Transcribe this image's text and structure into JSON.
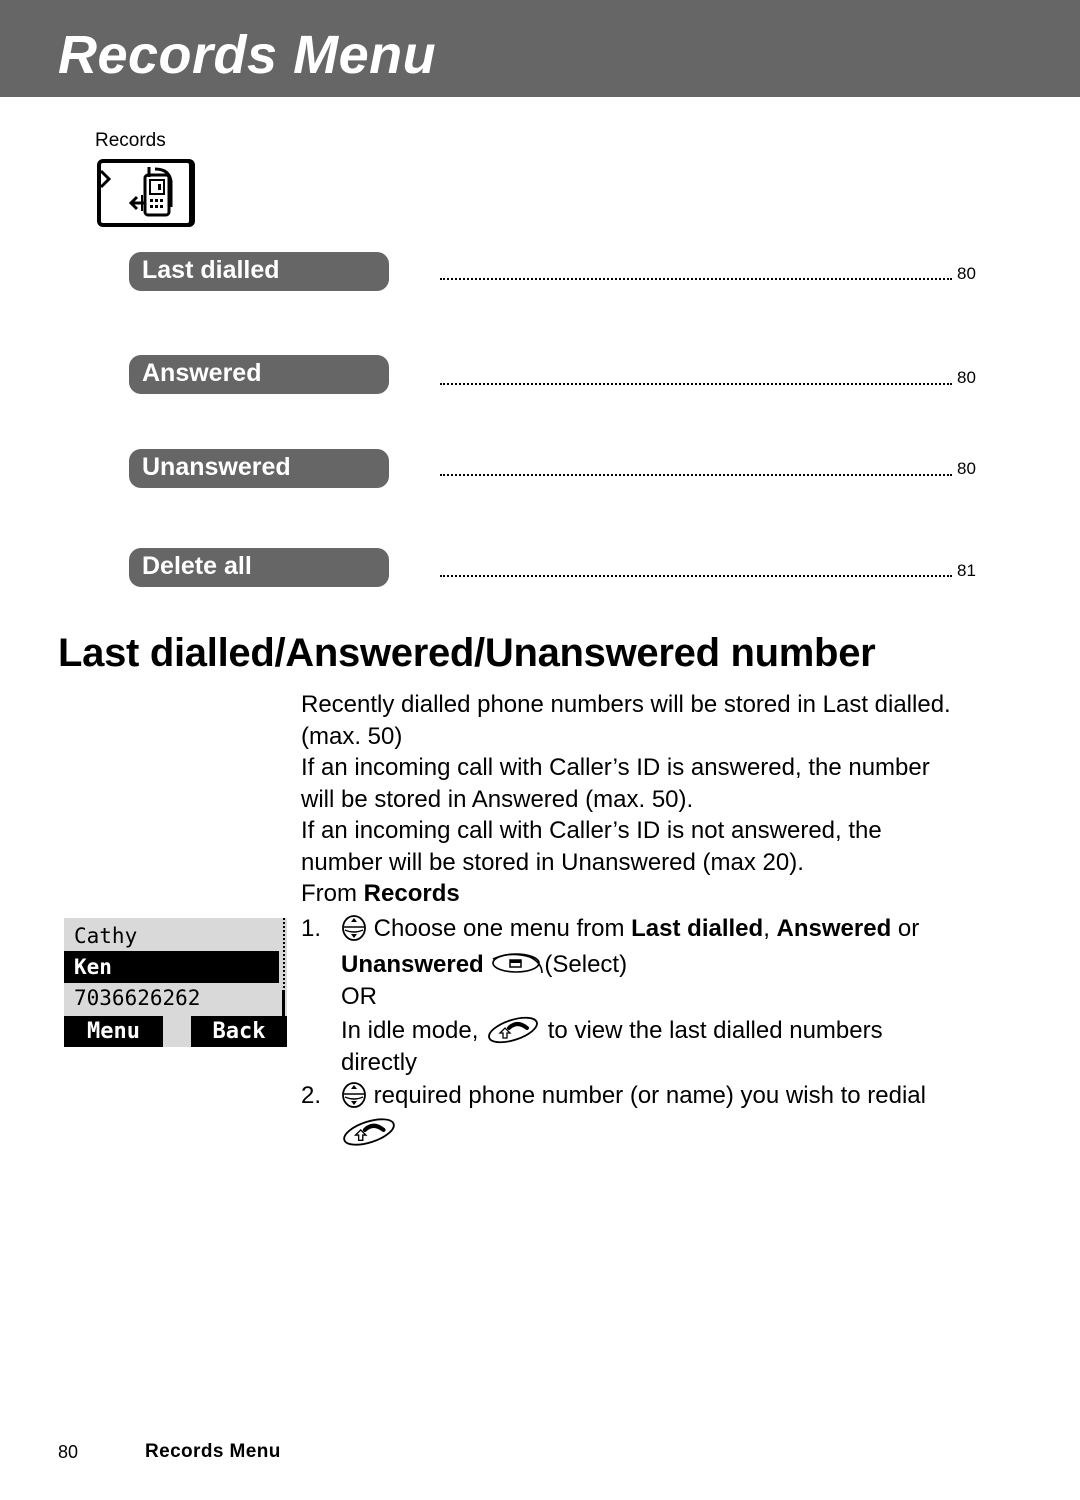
{
  "header": {
    "title": "Records Menu"
  },
  "records_section": {
    "label": "Records",
    "icon": "records-phone-icon"
  },
  "menu_items": [
    {
      "label": "Last dialled",
      "page": "80"
    },
    {
      "label": "Answered",
      "page": "80"
    },
    {
      "label": "Unanswered",
      "page": "80"
    },
    {
      "label": "Delete all",
      "page": "81"
    }
  ],
  "section": {
    "title": "Last dialled/Answered/Unanswered number",
    "paragraphs": [
      "Recently dialled phone numbers will be stored in Last dialled.",
      "(max. 50)",
      "If an incoming call with Caller’s ID is answered, the number",
      "will be stored in Answered (max. 50).",
      "If an incoming call with Caller’s ID is not answered, the",
      "number will be stored in Unanswered (max 20)."
    ],
    "from_prefix": "From ",
    "from_bold": "Records"
  },
  "steps": [
    {
      "num": "1.",
      "icon": "scroll-key-icon",
      "line1_text": " Choose one menu from ",
      "line1_bold_a": "Last dialled",
      "line1_sep": ", ",
      "line1_bold_b": "Answered",
      "line1_tail": " or",
      "line2_bold": "Unanswered",
      "line2_icon": "select-softkey-icon",
      "line2_tail": "(Select)",
      "or_label": "OR",
      "alt_prefix": "In idle mode, ",
      "alt_icon": "call-key-icon",
      "alt_tail": " to view the last dialled numbers",
      "alt_line2": "directly"
    },
    {
      "num": "2.",
      "icon": "scroll-key-icon",
      "text": " required phone number (or name) you wish to redial",
      "end_icon": "call-key-icon"
    }
  ],
  "phone_screen": {
    "rows": [
      "Cathy",
      "Ken",
      "7036626262"
    ],
    "selected_index": 1,
    "left_softkey": "Menu",
    "right_softkey": "Back"
  },
  "footer": {
    "page_number": "80",
    "title": "Records Menu"
  }
}
